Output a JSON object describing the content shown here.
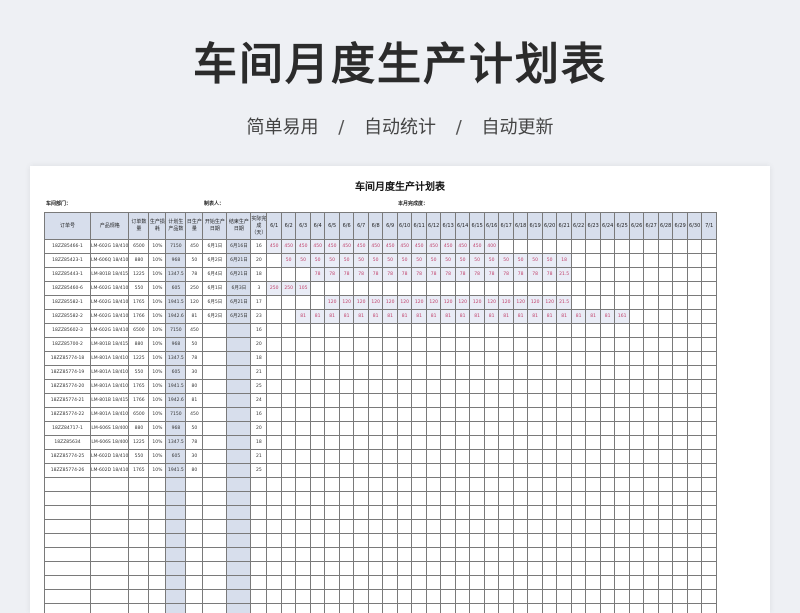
{
  "banner": {
    "title": "车间月度生产计划表",
    "subtitle_parts": [
      "简单易用",
      "自动统计",
      "自动更新"
    ],
    "separator": "/"
  },
  "sheet": {
    "title": "车间月度生产计划表",
    "dept_label": "车间部门：",
    "maker_label": "制表人：",
    "completion_label": "本月完成度："
  },
  "table": {
    "fixed_headers": [
      "订单号",
      "产品规格",
      "订单数量",
      "生产损耗",
      "计划生产品数",
      "日生产量",
      "开始生产日期",
      "结束生产日期",
      "实际完成（天）"
    ],
    "date_headers": [
      "6/1",
      "6/2",
      "6/3",
      "6/4",
      "6/5",
      "6/6",
      "6/7",
      "6/8",
      "6/9",
      "6/10",
      "6/11",
      "6/12",
      "6/13",
      "6/14",
      "6/15",
      "6/16",
      "6/17",
      "6/18",
      "6/19",
      "6/20",
      "6/21",
      "6/22",
      "6/23",
      "6/24",
      "6/25",
      "6/26",
      "6/27",
      "6/28",
      "6/29",
      "6/30",
      "7/1"
    ],
    "rows": [
      {
        "order": "18ZZ85466-1",
        "spec": "LM-602G 18/410",
        "qty": "6500",
        "loss": "10%",
        "plan": "7150",
        "daily": "450",
        "start": "6月1日",
        "end": "6月16日",
        "days": "16",
        "daily_qty": [
          "450",
          "450",
          "450",
          "450",
          "450",
          "450",
          "450",
          "450",
          "450",
          "450",
          "450",
          "450",
          "450",
          "450",
          "450",
          "400"
        ],
        "offset": 0
      },
      {
        "order": "18ZZ85423-1",
        "spec": "LM-606Q 18/410",
        "qty": "880",
        "loss": "10%",
        "plan": "968",
        "daily": "50",
        "start": "6月2日",
        "end": "6月21日",
        "days": "20",
        "daily_qty": [
          "50",
          "50",
          "50",
          "50",
          "50",
          "50",
          "50",
          "50",
          "50",
          "50",
          "50",
          "50",
          "50",
          "50",
          "50",
          "50",
          "50",
          "50",
          "50",
          "18"
        ],
        "offset": 1
      },
      {
        "order": "18ZZ85443-1",
        "spec": "LM-801B 18/415",
        "qty": "1225",
        "loss": "10%",
        "plan": "1347.5",
        "daily": "78",
        "start": "6月4日",
        "end": "6月21日",
        "days": "18",
        "daily_qty": [
          "78",
          "78",
          "78",
          "78",
          "78",
          "78",
          "78",
          "78",
          "78",
          "78",
          "78",
          "78",
          "78",
          "78",
          "78",
          "78",
          "78",
          "21.5"
        ],
        "offset": 3
      },
      {
        "order": "18ZZ85460-6",
        "spec": "LM-602G 18/410",
        "qty": "550",
        "loss": "10%",
        "plan": "605",
        "daily": "250",
        "start": "6月1日",
        "end": "6月3日",
        "days": "3",
        "daily_qty": [
          "250",
          "250",
          "105"
        ],
        "offset": 0
      },
      {
        "order": "18ZZ85582-1",
        "spec": "LM-602G 18/410",
        "qty": "1765",
        "loss": "10%",
        "plan": "1941.5",
        "daily": "120",
        "start": "6月5日",
        "end": "6月21日",
        "days": "17",
        "daily_qty": [
          "120",
          "120",
          "120",
          "120",
          "120",
          "120",
          "120",
          "120",
          "120",
          "120",
          "120",
          "120",
          "120",
          "120",
          "120",
          "120",
          "21.5"
        ],
        "offset": 4
      },
      {
        "order": "18ZZ85582-2",
        "spec": "LM-602G 18/410",
        "qty": "1766",
        "loss": "10%",
        "plan": "1942.6",
        "daily": "81",
        "start": "6月2日",
        "end": "6月25日",
        "days": "23",
        "daily_qty": [
          "81",
          "81",
          "81",
          "81",
          "81",
          "81",
          "81",
          "81",
          "81",
          "81",
          "81",
          "81",
          "81",
          "81",
          "81",
          "81",
          "81",
          "81",
          "81",
          "81",
          "81",
          "81",
          "161"
        ],
        "offset": 2
      },
      {
        "order": "18ZZ85602-3",
        "spec": "LM-602G 18/410",
        "qty": "6500",
        "loss": "10%",
        "plan": "7150",
        "daily": "450",
        "start": "",
        "end": "",
        "days": "16",
        "daily_qty": [],
        "offset": 0
      },
      {
        "order": "18ZZ85700-2",
        "spec": "LM-801B 18/415",
        "qty": "880",
        "loss": "10%",
        "plan": "968",
        "daily": "50",
        "start": "",
        "end": "",
        "days": "20",
        "daily_qty": [],
        "offset": 0
      },
      {
        "order": "18ZZ85774-18",
        "spec": "LM-801A 18/410",
        "qty": "1225",
        "loss": "10%",
        "plan": "1347.5",
        "daily": "78",
        "start": "",
        "end": "",
        "days": "18",
        "daily_qty": [],
        "offset": 0
      },
      {
        "order": "18ZZ85774-19",
        "spec": "LM-801A 18/410",
        "qty": "550",
        "loss": "10%",
        "plan": "605",
        "daily": "30",
        "start": "",
        "end": "",
        "days": "21",
        "daily_qty": [],
        "offset": 0
      },
      {
        "order": "18ZZ85774-20",
        "spec": "LM-801A 18/410",
        "qty": "1765",
        "loss": "10%",
        "plan": "1941.5",
        "daily": "80",
        "start": "",
        "end": "",
        "days": "25",
        "daily_qty": [],
        "offset": 0
      },
      {
        "order": "18ZZ85774-21",
        "spec": "LM-801B 18/415",
        "qty": "1766",
        "loss": "10%",
        "plan": "1942.6",
        "daily": "81",
        "start": "",
        "end": "",
        "days": "24",
        "daily_qty": [],
        "offset": 0
      },
      {
        "order": "18ZZ85774-22",
        "spec": "LM-801A 18/410",
        "qty": "6500",
        "loss": "10%",
        "plan": "7150",
        "daily": "450",
        "start": "",
        "end": "",
        "days": "16",
        "daily_qty": [],
        "offset": 0
      },
      {
        "order": "18ZZ84717-1",
        "spec": "LM-606S 18/400",
        "qty": "880",
        "loss": "10%",
        "plan": "968",
        "daily": "50",
        "start": "",
        "end": "",
        "days": "20",
        "daily_qty": [],
        "offset": 0
      },
      {
        "order": "18ZZ85634",
        "spec": "LM-606S 18/400",
        "qty": "1225",
        "loss": "10%",
        "plan": "1347.5",
        "daily": "78",
        "start": "",
        "end": "",
        "days": "18",
        "daily_qty": [],
        "offset": 0
      },
      {
        "order": "18ZZ85774-25",
        "spec": "LM-602D 18/410",
        "qty": "550",
        "loss": "10%",
        "plan": "605",
        "daily": "30",
        "start": "",
        "end": "",
        "days": "21",
        "daily_qty": [],
        "offset": 0
      },
      {
        "order": "18ZZ85774-26",
        "spec": "LM-602D 18/410",
        "qty": "1765",
        "loss": "10%",
        "plan": "1941.5",
        "daily": "80",
        "start": "",
        "end": "",
        "days": "25",
        "daily_qty": [],
        "offset": 0
      }
    ],
    "blank_rows": 11
  },
  "colors": {
    "header_fill": "#d7deec",
    "quantity_text": "#c0406a",
    "background": "#eef0f4"
  }
}
